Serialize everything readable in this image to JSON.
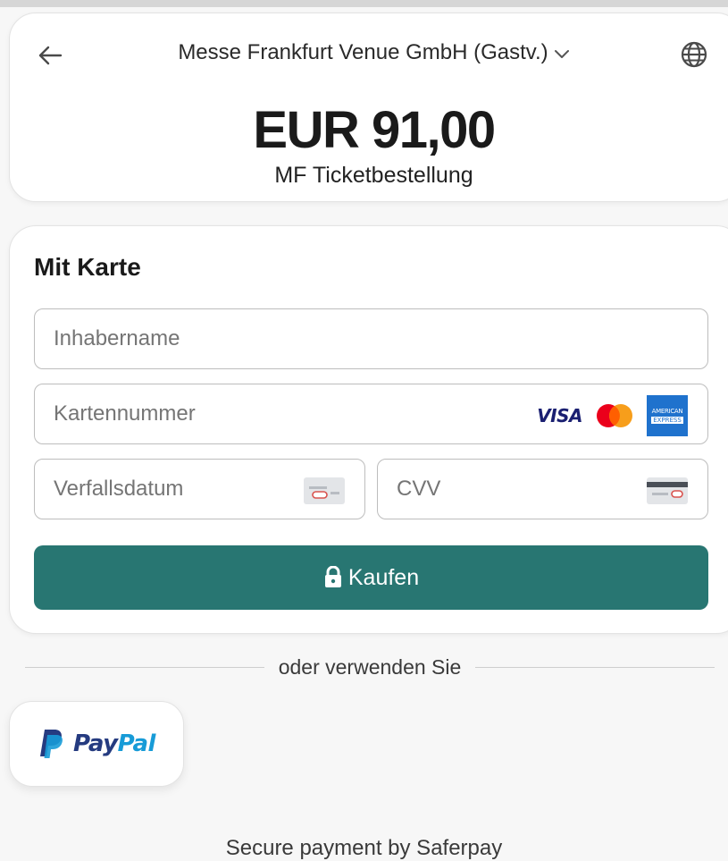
{
  "header": {
    "back_icon": "arrow-left-icon",
    "merchant": "Messe Frankfurt Venue GmbH (Gastv.)",
    "merchant_chevron_icon": "chevron-down-icon",
    "language_icon": "globe-icon",
    "amount": "EUR 91,00",
    "description": "MF Ticketbestellung"
  },
  "card_form": {
    "title": "Mit Karte",
    "cardholder_placeholder": "Inhabername",
    "card_number_placeholder": "Kartennummer",
    "card_brands": [
      "VISA",
      "Mastercard",
      "American Express"
    ],
    "expiry_placeholder": "Verfallsdatum",
    "cvv_placeholder": "CVV",
    "buy_label": "Kaufen",
    "buy_icon": "lock-icon",
    "amex_text_1": "AMERICAN",
    "amex_text_2": "EXPRESS"
  },
  "alternatives": {
    "divider_text": "oder verwenden Sie",
    "paypal_pay": "Pay",
    "paypal_pal": "Pal"
  },
  "footer": {
    "text": "Secure payment by Saferpay"
  },
  "colors": {
    "primary_button": "#287672",
    "paypal_dark": "#253b80",
    "paypal_light": "#179bd7",
    "visa": "#1a1f71",
    "amex": "#1f72cd"
  }
}
